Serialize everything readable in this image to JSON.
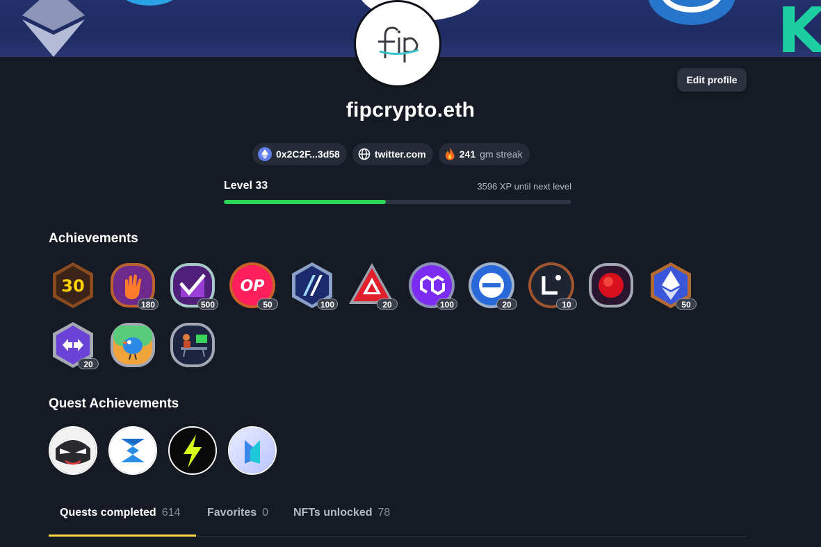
{
  "profile": {
    "username": "fipcrypto.eth",
    "avatar_text": "fip",
    "edit_label": "Edit profile"
  },
  "chips": {
    "address": "0x2C2F...3d58",
    "website": "twitter.com",
    "streak_count": "241",
    "streak_label": "gm streak"
  },
  "level": {
    "label": "Level 33",
    "xp_text": "3596 XP until next level",
    "progress": 0.465
  },
  "achievements": {
    "title": "Achievements",
    "badges": [
      {
        "name": "thirty-days-badge",
        "icon": "30",
        "count": ""
      },
      {
        "name": "gm-hand-badge",
        "icon": "hand-icon",
        "count": "180"
      },
      {
        "name": "checkmark-badge",
        "icon": "check-icon",
        "count": "500"
      },
      {
        "name": "optimism-badge",
        "icon": "OP",
        "count": "50"
      },
      {
        "name": "arbitrum-badge",
        "icon": "arbitrum-icon",
        "count": "100"
      },
      {
        "name": "avalanche-badge",
        "icon": "avalanche-icon",
        "count": "20"
      },
      {
        "name": "polygon-badge",
        "icon": "polygon-icon",
        "count": "100"
      },
      {
        "name": "usdc-badge",
        "icon": "minus-circle-icon",
        "count": "20"
      },
      {
        "name": "linea-badge",
        "icon": "linea-icon",
        "count": "10"
      },
      {
        "name": "red-orb-badge",
        "icon": "orb-icon",
        "count": ""
      },
      {
        "name": "ethereum-badge",
        "icon": "ethereum-icon",
        "count": "50"
      },
      {
        "name": "bridge-badge",
        "icon": "swap-arrows-icon",
        "count": "20"
      },
      {
        "name": "bird-badge",
        "icon": "bird-icon",
        "count": ""
      },
      {
        "name": "desk-worker-badge",
        "icon": "computer-desk-icon",
        "count": ""
      }
    ]
  },
  "quest_achievements": {
    "title": "Quest Achievements",
    "items": [
      {
        "name": "masked-character-quest",
        "icon": "mask-face-icon"
      },
      {
        "name": "blue-z-quest",
        "icon": "z-logo-icon"
      },
      {
        "name": "lightning-quest",
        "icon": "lightning-icon"
      },
      {
        "name": "crystal-quest",
        "icon": "crystal-logo-icon"
      }
    ]
  },
  "tabs": [
    {
      "label": "Quests completed",
      "count": "614",
      "active": true
    },
    {
      "label": "Favorites",
      "count": "0",
      "active": false
    },
    {
      "label": "NFTs unlocked",
      "count": "78",
      "active": false
    }
  ],
  "colors": {
    "background": "#161a24",
    "progress_fill": "#2ed456",
    "active_tab_underline": "#ffd84a"
  }
}
